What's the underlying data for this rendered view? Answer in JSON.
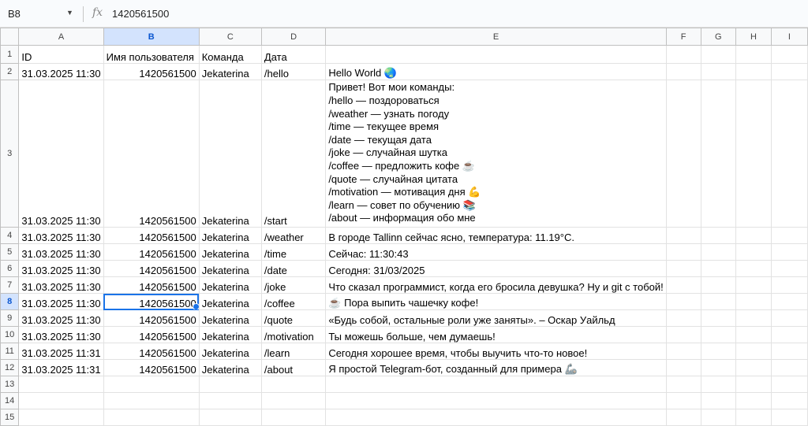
{
  "formula_bar": {
    "name_box": "B8",
    "fx_symbol": "fx",
    "value": "1420561500"
  },
  "columns": [
    "A",
    "B",
    "C",
    "D",
    "E",
    "F",
    "G",
    "H",
    "I"
  ],
  "selected_column": "B",
  "selected_row": "8",
  "rows": [
    {
      "n": "1",
      "a": "ID",
      "b": "Имя пользователя",
      "c": "Команда",
      "d": "Дата",
      "e": ""
    },
    {
      "n": "2",
      "a": "31.03.2025 11:30",
      "b": "1420561500",
      "c": "Jekaterina",
      "d": "/hello",
      "e": "Hello World 🌏"
    },
    {
      "n": "3",
      "a": "31.03.2025 11:30",
      "b": "1420561500",
      "c": "Jekaterina",
      "d": "/start",
      "e": "Привет! Вот мои команды:\n/hello — поздороваться\n/weather — узнать погоду\n/time — текущее время\n/date — текущая дата\n/joke — случайная шутка\n/coffee — предложить кофе ☕\n/quote — случайная цитата\n/motivation — мотивация дня 💪\n/learn — совет по обучению 📚\n/about — информация обо мне"
    },
    {
      "n": "4",
      "a": "31.03.2025 11:30",
      "b": "1420561500",
      "c": "Jekaterina",
      "d": "/weather",
      "e": "В городе Tallinn сейчас ясно, температура: 11.19°C."
    },
    {
      "n": "5",
      "a": "31.03.2025 11:30",
      "b": "1420561500",
      "c": "Jekaterina",
      "d": "/time",
      "e": "Сейчас: 11:30:43"
    },
    {
      "n": "6",
      "a": "31.03.2025 11:30",
      "b": "1420561500",
      "c": "Jekaterina",
      "d": "/date",
      "e": "Сегодня: 31/03/2025"
    },
    {
      "n": "7",
      "a": "31.03.2025 11:30",
      "b": "1420561500",
      "c": "Jekaterina",
      "d": "/joke",
      "e": "Что сказал программист, когда его бросила девушка? Ну и git с тобой!"
    },
    {
      "n": "8",
      "a": "31.03.2025 11:30",
      "b": "1420561500",
      "c": "Jekaterina",
      "d": "/coffee",
      "e": "☕ Пора выпить чашечку кофе!"
    },
    {
      "n": "9",
      "a": "31.03.2025 11:30",
      "b": "1420561500",
      "c": "Jekaterina",
      "d": "/quote",
      "e": "«Будь собой, остальные роли уже заняты». – Оскар Уайльд"
    },
    {
      "n": "10",
      "a": "31.03.2025 11:30",
      "b": "1420561500",
      "c": "Jekaterina",
      "d": "/motivation",
      "e": "Ты можешь больше, чем думаешь!"
    },
    {
      "n": "11",
      "a": "31.03.2025 11:31",
      "b": "1420561500",
      "c": "Jekaterina",
      "d": "/learn",
      "e": "Сегодня хорошее время, чтобы выучить что-то новое!"
    },
    {
      "n": "12",
      "a": "31.03.2025 11:31",
      "b": "1420561500",
      "c": "Jekaterina",
      "d": "/about",
      "e": "Я простой Telegram-бот, созданный для примера 🦾"
    },
    {
      "n": "13",
      "a": "",
      "b": "",
      "c": "",
      "d": "",
      "e": ""
    },
    {
      "n": "14",
      "a": "",
      "b": "",
      "c": "",
      "d": "",
      "e": ""
    },
    {
      "n": "15",
      "a": "",
      "b": "",
      "c": "",
      "d": "",
      "e": ""
    }
  ]
}
